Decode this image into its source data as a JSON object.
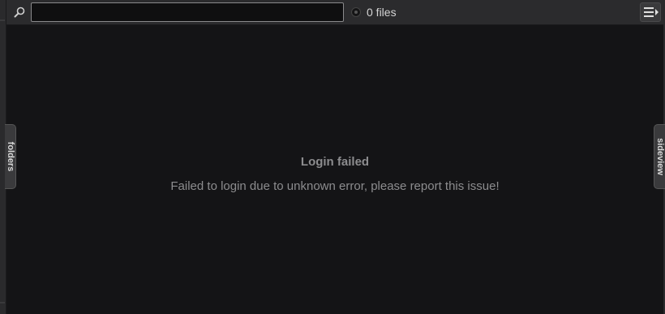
{
  "toolbar": {
    "search": {
      "value": "",
      "placeholder": ""
    },
    "files_count": "0 files"
  },
  "side_tabs": {
    "left_label": "folders",
    "right_label": "sideview"
  },
  "message": {
    "title": "Login failed",
    "body": "Failed to login due to unknown error, please report this issue!"
  },
  "icons": {
    "search": "search-icon",
    "files_status": "status-dot-icon",
    "menu": "list-menu-icon"
  },
  "colors": {
    "background": "#141416",
    "toolbar": "#2b2b2d",
    "message_text": "#8c8c8e",
    "files_text": "#d4d4d4"
  }
}
